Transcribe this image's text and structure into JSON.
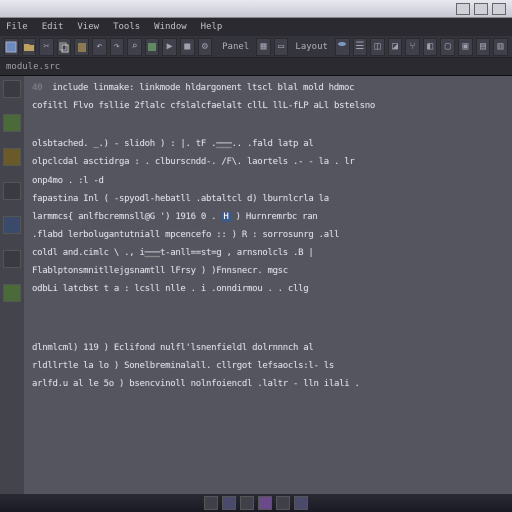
{
  "window": {
    "title": ""
  },
  "menu": {
    "items": [
      "File",
      "Edit",
      "View",
      "Tools",
      "Window",
      "Help"
    ]
  },
  "toolbar": {
    "right_labels": [
      "Panel",
      "Layout"
    ],
    "icons": [
      "save",
      "open",
      "cut",
      "copy",
      "paste",
      "undo",
      "redo",
      "find",
      "build",
      "run",
      "stop",
      "cfg",
      "grid",
      "view",
      "db",
      "tree",
      "box",
      "box2",
      "branch",
      "mod",
      "sq1",
      "sq2",
      "sq3",
      "sq4"
    ]
  },
  "tab": {
    "filename": "module.src"
  },
  "editor": {
    "lines": [
      {
        "n": "40",
        "t": "include  linmake:  linkmode  hldargonent  ltscl  blal  mold hdmoc"
      },
      {
        "n": "",
        "t": "cofiltl  Flvo fsllie 2flalc  cfslalcfaelalt cllL llL-fLP  aLl  bstelsno"
      },
      {
        "n": "",
        "t": ""
      },
      {
        "n": "",
        "t": "olsbtached.  _.)  - slidoh ) :  |.  tF .===..  .fald  latp al"
      },
      {
        "n": "",
        "t": "olpclcdal  asctidrga : . clburscndd-. /F\\. laortels  .- - la . lr"
      },
      {
        "n": "",
        "t": "onp4mo                             . :l -d"
      },
      {
        "n": "",
        "t": "fapastina Inl  (  -spyodl-hebatll .abtaltcl d) lburnlcrla  la"
      },
      {
        "n": "",
        "t": "larmmcs{ anlfbcremnsll@G ') 1916 0 .  [H]  ) Hurnremrbc  ran"
      },
      {
        "n": "",
        "t": ".flabd  lerbolugantutniall mpcencefo :: ) R :  sorrosunrg .all"
      },
      {
        "n": "",
        "t": "coldl and.cimlc \\ ., i===t-anll==st=g ,      arnsnolcls .B |"
      },
      {
        "n": "",
        "t": "Flablptonsmnitllejgsnamtll lFrsy  )    )Fnnsnecr. mgsc"
      },
      {
        "n": "",
        "t": "odbLi  latcbst t a  : lcsll  nlle . i  .onndirmou .  . cllg"
      },
      {
        "n": "",
        "t": ""
      },
      {
        "n": "",
        "t": ""
      },
      {
        "n": "",
        "t": "dlnmlcml)  119  )   Eclifond nulfl'lsnenfieldl  dolrnnnch  al"
      },
      {
        "n": "",
        "t": "rldllrtle la lo  )   Sonelbreminalall. cllrgot  lefsaocls:l- ls"
      },
      {
        "n": "",
        "t": "arlfd.u al le 5o  )   bsencvinoll nolnfoiencdl .laltr - lln  ilali ."
      }
    ],
    "highlight_token": "H"
  },
  "taskbar": {
    "icons": [
      "app1",
      "app2",
      "app3",
      "app4",
      "app5",
      "app6"
    ]
  }
}
